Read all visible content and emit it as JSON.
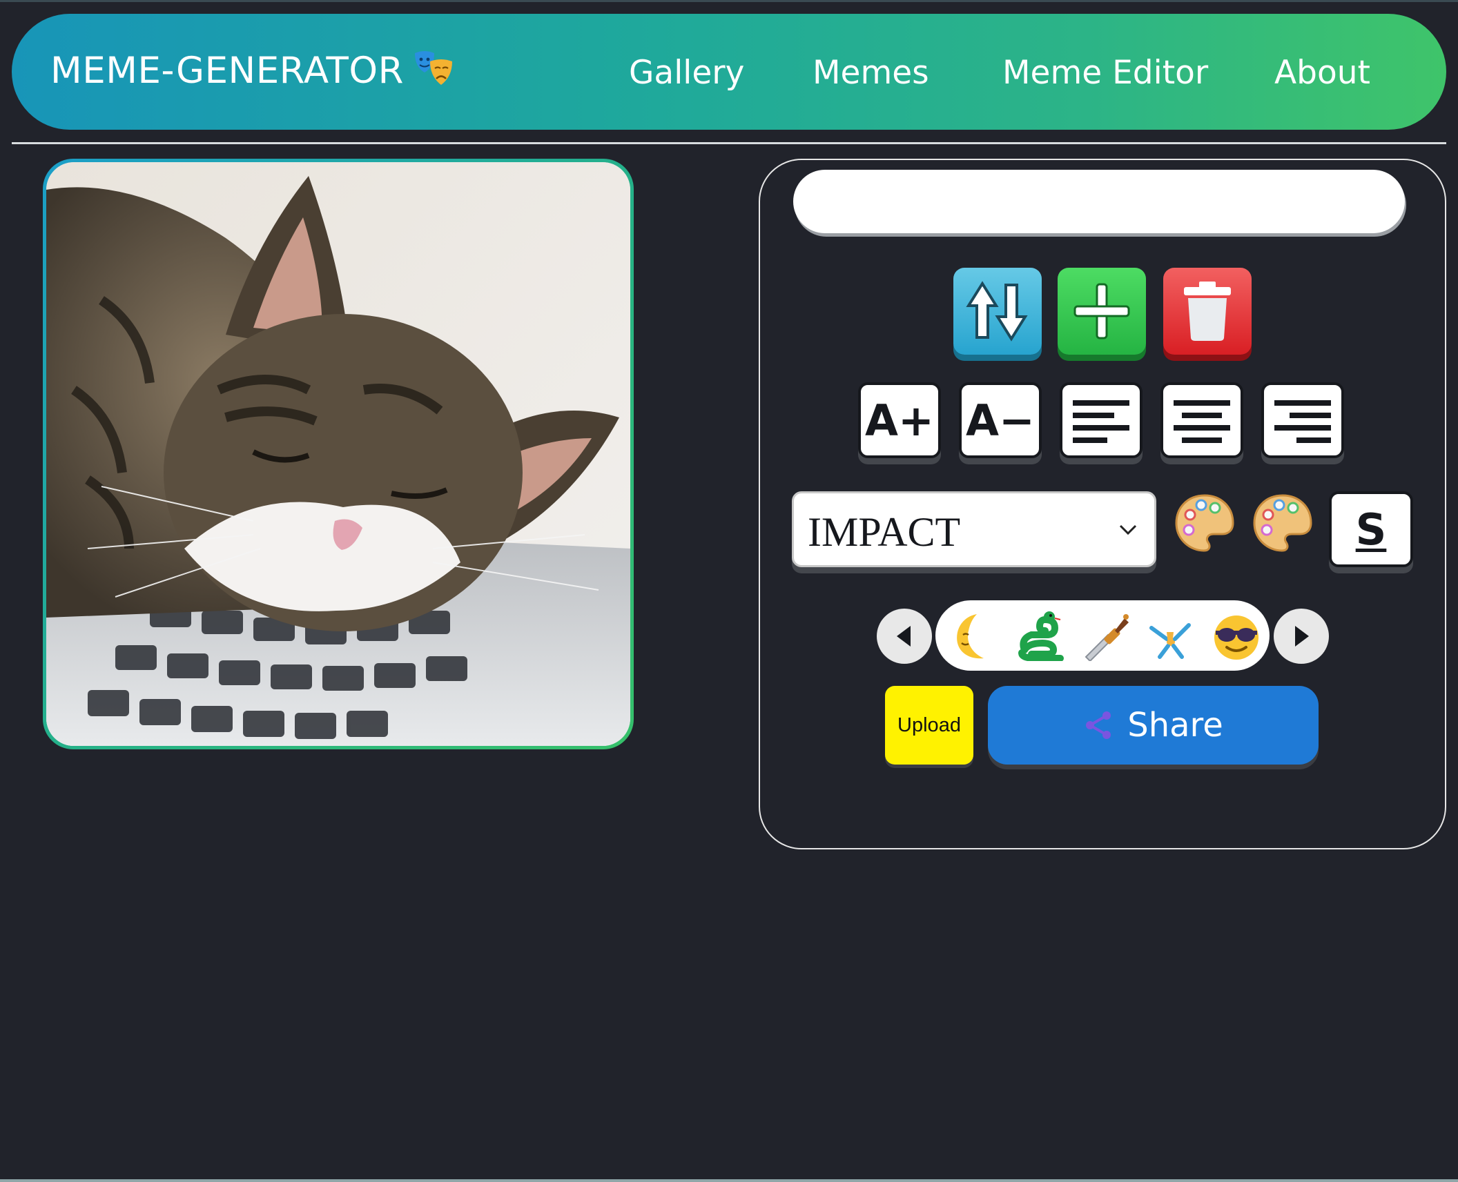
{
  "header": {
    "logo_text": "MEME-GENERATOR",
    "logo_icon": "performing-arts-masks-icon",
    "nav": [
      "Gallery",
      "Memes",
      "Meme Editor",
      "About"
    ]
  },
  "canvas": {
    "image": "sleeping-tabby-cat-on-laptop-keyboard"
  },
  "editor": {
    "text_input": {
      "value": "",
      "placeholder": ""
    },
    "line_controls": [
      "switch-lines-icon",
      "add-line-icon",
      "delete-line-icon"
    ],
    "font_size": {
      "increase_label": "A+",
      "decrease_label": "A−"
    },
    "align": [
      "align-left-icon",
      "align-center-icon",
      "align-right-icon"
    ],
    "font_select": {
      "selected": "IMPACT"
    },
    "color_pickers": [
      "palette-icon",
      "palette-icon"
    ],
    "stroke_label": "S",
    "stickers": [
      "crescent-moon-face-icon",
      "snake-icon",
      "dagger-icon",
      "cartwheel-person-icon",
      "sunglasses-face-icon"
    ],
    "upload_label": "Upload",
    "share_label": "Share",
    "share_icon": "share-nodes-icon"
  },
  "colors": {
    "background": "#21232b",
    "header_gradient": [
      "#1895b8",
      "#3fc46a"
    ],
    "upload": "#fff200",
    "share": "#1f7ad6"
  }
}
